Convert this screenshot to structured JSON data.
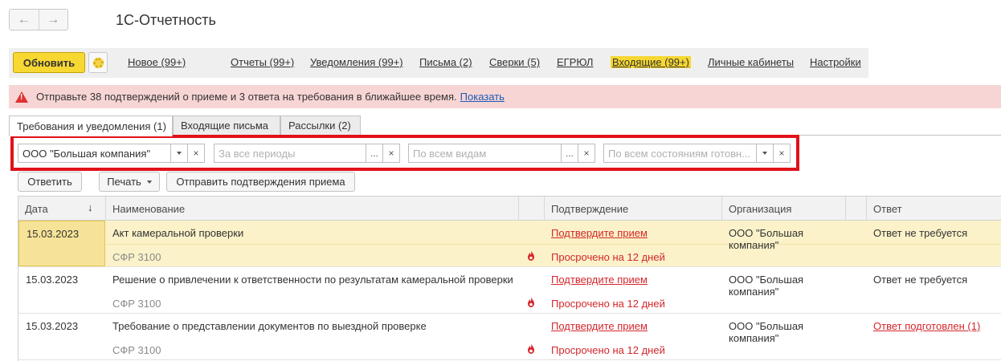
{
  "header": {
    "back_glyph": "←",
    "forward_glyph": "→",
    "title": "1С-Отчетность"
  },
  "toolbar": {
    "update_label": "Обновить",
    "settings_icon": "gear-icon",
    "links": [
      {
        "label": "Новое (99+)"
      },
      {
        "label": "Отчеты (99+)"
      },
      {
        "label": "Уведомления (99+)"
      },
      {
        "label": "Письма (2)"
      },
      {
        "label": "Сверки (5)"
      },
      {
        "label": "ЕГРЮЛ"
      },
      {
        "label": "Входящие (99+)",
        "active": true
      },
      {
        "label": "Личные кабинеты"
      },
      {
        "label": "Настройки"
      }
    ]
  },
  "warning": {
    "text": "Отправьте 38 подтверждений о приеме и 3 ответа на требования в ближайшее время.",
    "link": "Показать"
  },
  "tabs": [
    {
      "label": "Требования и уведомления (1)",
      "active": true
    },
    {
      "label": "Входящие письма"
    },
    {
      "label": "Рассылки (2)"
    }
  ],
  "filters": {
    "organization": "ООО \"Большая компания\"",
    "period_placeholder": "За все периоды",
    "type_placeholder": "По всем видам",
    "state_placeholder": "По всем состояниям готовн...",
    "dots": "...",
    "clear": "×"
  },
  "actions": {
    "reply": "Ответить",
    "print": "Печать",
    "send_confirmations": "Отправить подтверждения приема"
  },
  "table": {
    "columns": {
      "date": "Дата",
      "sort_glyph": "↓",
      "name": "Наименование",
      "confirmation": "Подтверждение",
      "organization": "Организация",
      "answer": "Ответ"
    },
    "rows": [
      {
        "date": "15.03.2023",
        "name": "Акт камеральной проверки",
        "sender": "СФР 3100",
        "confirm": "Подтвердите прием",
        "overdue": "Просрочено на 12 дней",
        "org": "ООО \"Большая компания\"",
        "answer": "Ответ не требуется",
        "answer_is_link": false,
        "selected": true
      },
      {
        "date": "15.03.2023",
        "name": "Решение о привлечении к ответственности по результатам камеральной проверки",
        "sender": "СФР 3100",
        "confirm": "Подтвердите прием",
        "overdue": "Просрочено на 12 дней",
        "org": "ООО \"Большая компания\"",
        "answer": "Ответ не требуется",
        "answer_is_link": false,
        "selected": false
      },
      {
        "date": "15.03.2023",
        "name": "Требование о представлении документов по выездной проверке",
        "sender": "СФР 3100",
        "confirm": "Подтвердите прием",
        "overdue": "Просрочено на 12 дней",
        "org": "ООО \"Большая компания\"",
        "answer": "Ответ подготовлен (1)",
        "answer_is_link": true,
        "selected": false
      }
    ]
  },
  "colors": {
    "accent_yellow": "#f7d731",
    "warning_bg": "#f8d5d5",
    "link_red": "#d4272c",
    "link_blue": "#1a5ab4",
    "highlight_frame": "#e0121a"
  }
}
